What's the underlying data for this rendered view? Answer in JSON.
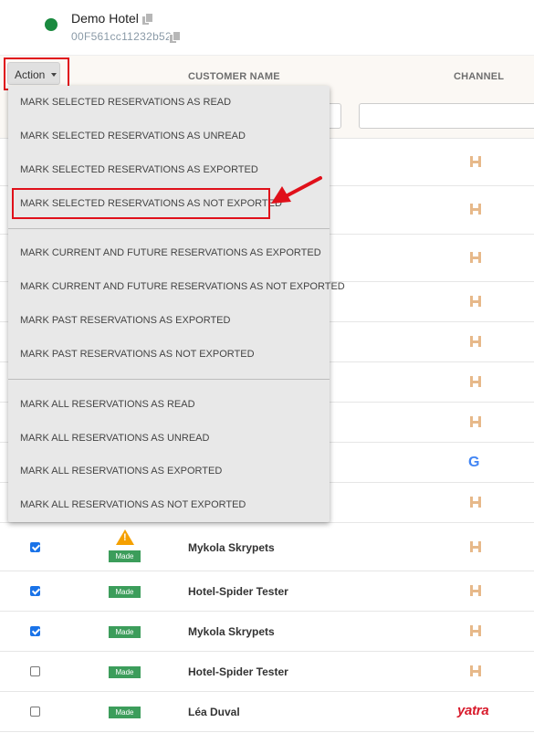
{
  "header": {
    "hotel_name": "Demo Hotel",
    "hotel_id": "00F561cc11232b52",
    "status_color": "#1a8a3f"
  },
  "table": {
    "action_label": "Action",
    "columns": [
      "CUSTOMER NAME",
      "CHANNEL"
    ]
  },
  "menu": {
    "items": [
      "MARK SELECTED RESERVATIONS AS READ",
      "MARK SELECTED RESERVATIONS AS UNREAD",
      "MARK SELECTED RESERVATIONS AS EXPORTED",
      "MARK SELECTED RESERVATIONS AS NOT EXPORTED",
      "MARK CURRENT AND FUTURE RESERVATIONS AS EXPORTED",
      "MARK CURRENT AND FUTURE RESERVATIONS AS NOT EXPORTED",
      "MARK PAST RESERVATIONS AS EXPORTED",
      "MARK PAST RESERVATIONS AS NOT EXPORTED",
      "MARK ALL RESERVATIONS AS READ",
      "MARK ALL RESERVATIONS AS UNREAD",
      "MARK ALL RESERVATIONS AS EXPORTED",
      "MARK ALL RESERVATIONS AS NOT EXPORTED"
    ],
    "highlighted_item": "MARK SELECTED RESERVATIONS AS NOT EXPORTED"
  },
  "rows": [
    {
      "checked": true,
      "status": "Made",
      "customer": "Mykola Skrypets",
      "channel": "hotel-spider-icon",
      "warning": true
    },
    {
      "checked": true,
      "status": "Made",
      "customer": "Hotel-Spider Tester",
      "channel": "hotel-spider-icon",
      "warning": false
    },
    {
      "checked": true,
      "status": "Made",
      "customer": "Mykola Skrypets",
      "channel": "hotel-spider-icon",
      "warning": false
    },
    {
      "checked": false,
      "status": "Made",
      "customer": "Hotel-Spider Tester",
      "channel": "hotel-spider-icon",
      "warning": false
    },
    {
      "checked": false,
      "status": "Made",
      "customer": "Léa Duval",
      "channel": "yatra",
      "warning": false
    }
  ],
  "channel_labels": {
    "google": "G",
    "yatra": "yatra"
  },
  "colors": {
    "highlight": "#e0101a",
    "badge_green": "#3c9d5b",
    "checkbox_blue": "#1a73e8",
    "warning_orange": "#f5a000"
  }
}
